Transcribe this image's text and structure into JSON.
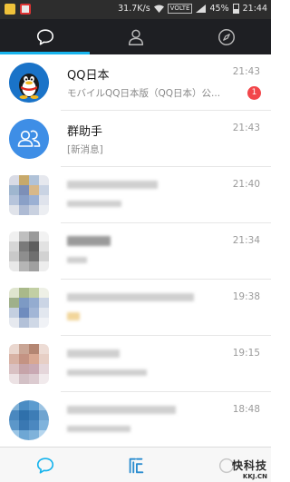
{
  "status_bar": {
    "network_speed": "31.7K/s",
    "volte": "VOLTE",
    "battery": "45%",
    "time": "21:44"
  },
  "top_tabs": [
    {
      "name": "messages",
      "icon": "chat-bubble-icon",
      "active": true
    },
    {
      "name": "contacts",
      "icon": "person-icon",
      "active": false
    },
    {
      "name": "discover",
      "icon": "compass-icon",
      "active": false
    }
  ],
  "conversations": [
    {
      "title": "QQ日本",
      "subtitle": "モバイルQQ日本版（QQ日本）公...",
      "time": "21:43",
      "badge": "1",
      "avatar": "qq-penguin-icon"
    },
    {
      "title": "群助手",
      "subtitle": "[新消息]",
      "time": "21:43",
      "avatar": "group-helper-icon"
    },
    {
      "title": "",
      "subtitle": "",
      "time": "21:40",
      "avatar": "blurred-avatar"
    },
    {
      "title": "",
      "subtitle": "",
      "time": "21:34",
      "avatar": "blurred-avatar"
    },
    {
      "title": "",
      "subtitle": "",
      "time": "19:38",
      "avatar": "blurred-avatar"
    },
    {
      "title": "",
      "subtitle": "",
      "time": "19:15",
      "avatar": "blurred-avatar"
    },
    {
      "title": "",
      "subtitle": "",
      "time": "18:48",
      "avatar": "blurred-avatar"
    }
  ],
  "bottom_tabs": [
    {
      "name": "chat",
      "icon": "chat-bubble-icon"
    },
    {
      "name": "qzone",
      "icon": "qzone-icon"
    },
    {
      "name": "more",
      "icon": "more-icon"
    }
  ],
  "watermark": {
    "line1": "快科技",
    "line2": "KKJ.CN"
  },
  "colors": {
    "accent": "#18b4ed",
    "badge": "#f2464a",
    "topbar": "#1e1f23"
  }
}
